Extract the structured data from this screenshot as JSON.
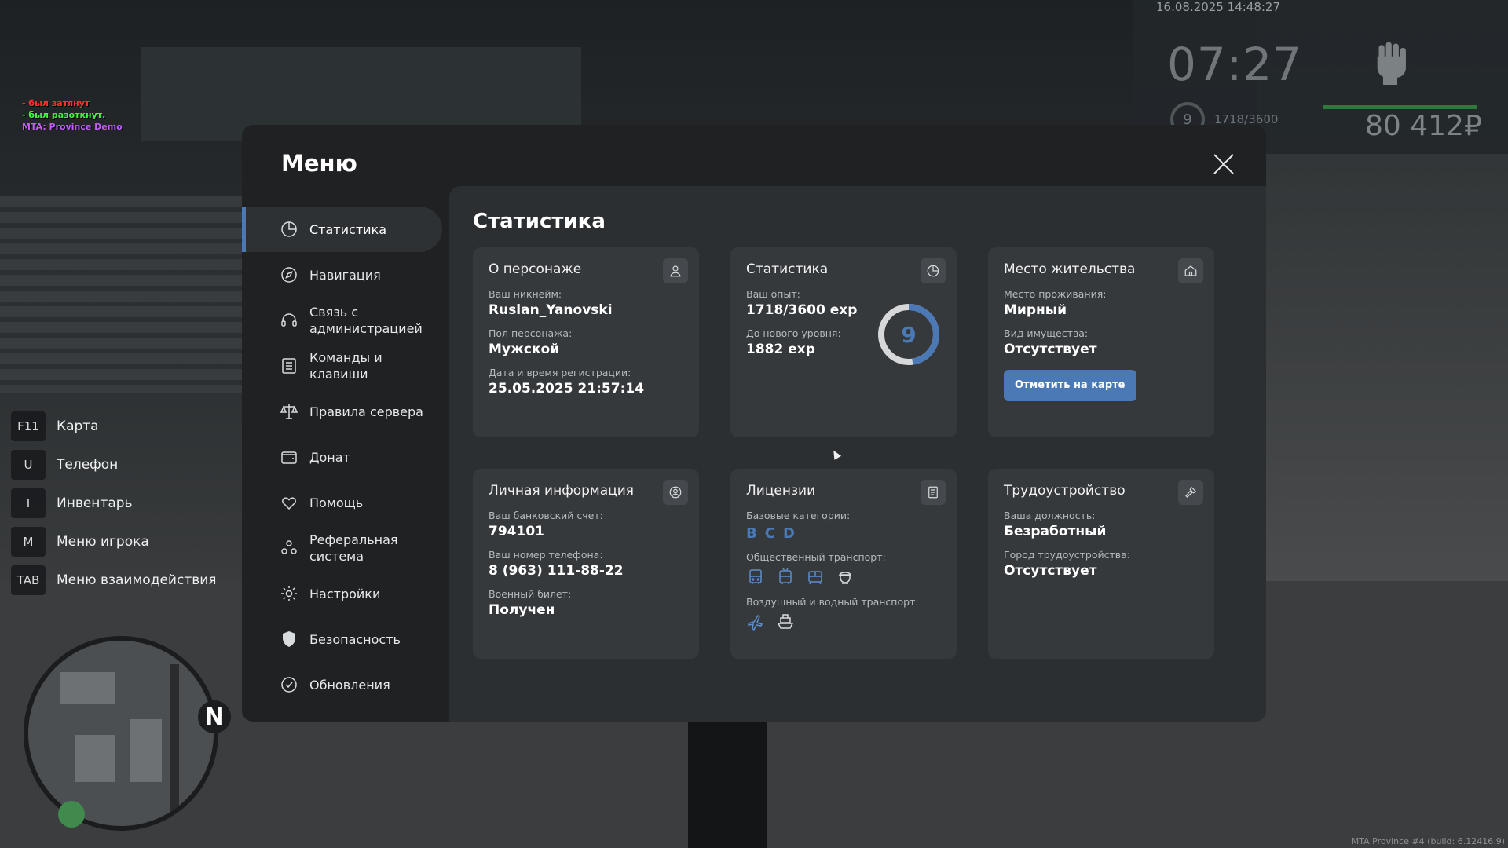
{
  "chat": {
    "line1": "- был затянут",
    "line2": "- был разоткнут.",
    "line3": "MTA: Province Demo"
  },
  "hud": {
    "date": "16.08.2025 14:48:27",
    "time": "07:27",
    "level": "9",
    "exp": "1718/3600",
    "money": "80 412₽"
  },
  "hotkeys": [
    {
      "key": "F11",
      "label": "Карта"
    },
    {
      "key": "U",
      "label": "Телефон"
    },
    {
      "key": "I",
      "label": "Инвентарь"
    },
    {
      "key": "M",
      "label": "Меню игрока"
    },
    {
      "key": "TAB",
      "label": "Меню взаимодействия"
    }
  ],
  "minimap": {
    "north": "N"
  },
  "build_info": "MTA Province #4 (build: 6.12416.9)",
  "menu": {
    "title": "Меню",
    "nav": [
      {
        "label": "Статистика",
        "icon": "pie-chart-icon"
      },
      {
        "label": "Навигация",
        "icon": "compass-icon"
      },
      {
        "label": "Связь с администрацией",
        "icon": "headset-icon"
      },
      {
        "label": "Команды и клавиши",
        "icon": "list-icon"
      },
      {
        "label": "Правила сервера",
        "icon": "scales-icon"
      },
      {
        "label": "Донат",
        "icon": "wallet-icon"
      },
      {
        "label": "Помощь",
        "icon": "heart-hands-icon"
      },
      {
        "label": "Реферальная система",
        "icon": "users-icon"
      },
      {
        "label": "Настройки",
        "icon": "gear-icon"
      },
      {
        "label": "Безопасность",
        "icon": "shield-icon"
      },
      {
        "label": "Обновления",
        "icon": "check-circle-icon"
      }
    ],
    "active_nav": "Статистика"
  },
  "content": {
    "title": "Статистика",
    "character": {
      "title": "О персонаже",
      "icon": "user-icon",
      "nickname_label": "Ваш никнейм:",
      "nickname": "Ruslan_Yanovski",
      "gender_label": "Пол персонажа:",
      "gender": "Мужской",
      "reg_label": "Дата и время регистрации:",
      "reg": "25.05.2025 21:57:14"
    },
    "stats": {
      "title": "Статистика",
      "icon": "pie-chart-icon",
      "exp_label": "Ваш опыт:",
      "exp": "1718/3600 exp",
      "next_label": "До нового уровня:",
      "next": "1882 exp",
      "level": "9",
      "level_progress": 0.477,
      "ring_color": "#4a79b6"
    },
    "residence": {
      "title": "Место жительства",
      "icon": "house-icon",
      "place_label": "Место проживания:",
      "place": "Мирный",
      "property_label": "Вид имущества:",
      "property": "Отсутствует",
      "button": "Отметить на карте"
    },
    "personal": {
      "title": "Личная информация",
      "icon": "user-circle-icon",
      "bank_label": "Ваш банковский счет:",
      "bank": "794101",
      "phone_label": "Ваш номер телефона:",
      "phone": "8 (963) 111-88-22",
      "military_label": "Военный билет:",
      "military": "Получен"
    },
    "licenses": {
      "title": "Лицензии",
      "icon": "document-icon",
      "base_label": "Базовые категории:",
      "categories": [
        "B",
        "C",
        "D"
      ],
      "public_label": "Общественный транспорт:",
      "public_icons": [
        "bus-icon",
        "trolleybus-icon",
        "tram-icon",
        "taxi-driver-icon"
      ],
      "air_label": "Воздушный и водный транспорт:",
      "air_icons": [
        "plane-icon",
        "boat-icon"
      ],
      "accent": "#5d8dcb"
    },
    "employment": {
      "title": "Трудоустройство",
      "icon": "hammer-icon",
      "position_label": "Ваша должность:",
      "position": "Безработный",
      "city_label": "Город трудоустройства:",
      "city": "Отсутствует"
    }
  }
}
